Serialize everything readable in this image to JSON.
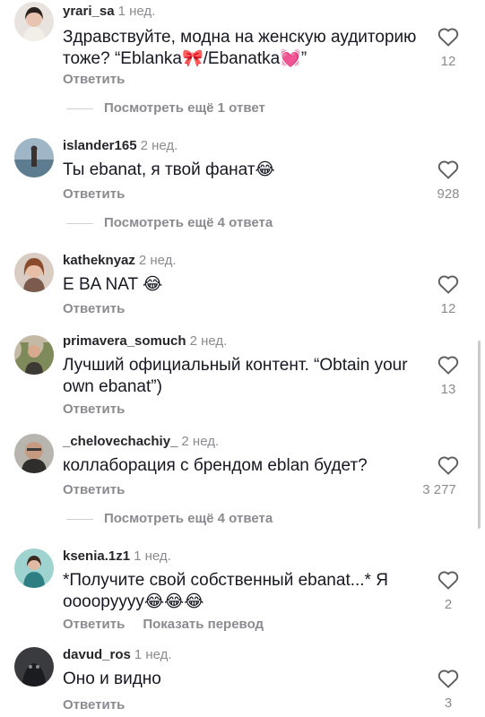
{
  "reply_label": "Ответить",
  "comments": [
    {
      "username": "yrari_sa",
      "date": "1 нед.",
      "text": "Здравствуйте, модна на женскую аудиторию тоже? “Eblanka🎀/Ebanatka💓”",
      "likes": "12",
      "avatar": "avatar-woman-dark-hair",
      "replies": "Посмотреть ещё 1 ответ"
    },
    {
      "username": "islander165",
      "date": "2 нед.",
      "text": "Ты ebanat, я твой фанат😂",
      "likes": "928",
      "avatar": "avatar-seaside-figure",
      "replies": "Посмотреть ещё 4 ответа"
    },
    {
      "username": "katheknyaz",
      "date": "2 нед.",
      "text": "E BA NAT 😂",
      "likes": "12",
      "avatar": "avatar-woman-red-hair"
    },
    {
      "username": "primavera_somuch",
      "date": "2 нед.",
      "text": "Лучший официальный контент. “Obtain your own ebanat”)",
      "likes": "13",
      "avatar": "avatar-person-plant"
    },
    {
      "username": "_chelovechachiy_",
      "date": "2 нед.",
      "text": "коллаборация с брендом eblan будет?",
      "likes": "3 277",
      "avatar": "avatar-bald-man",
      "replies": "Посмотреть ещё 4 ответа"
    },
    {
      "username": "ksenia.1z1",
      "date": "1 нед.",
      "text": "*Получите свой собственный ebanat...* Я оооорyyyy😂😂😂",
      "likes": "2",
      "avatar": "avatar-woman-teal",
      "translate": "Показать перевод"
    },
    {
      "username": "davud_ros",
      "date": "1 нед.",
      "text": "Оно и видно",
      "likes": "3",
      "avatar": "avatar-dark-creature"
    }
  ]
}
